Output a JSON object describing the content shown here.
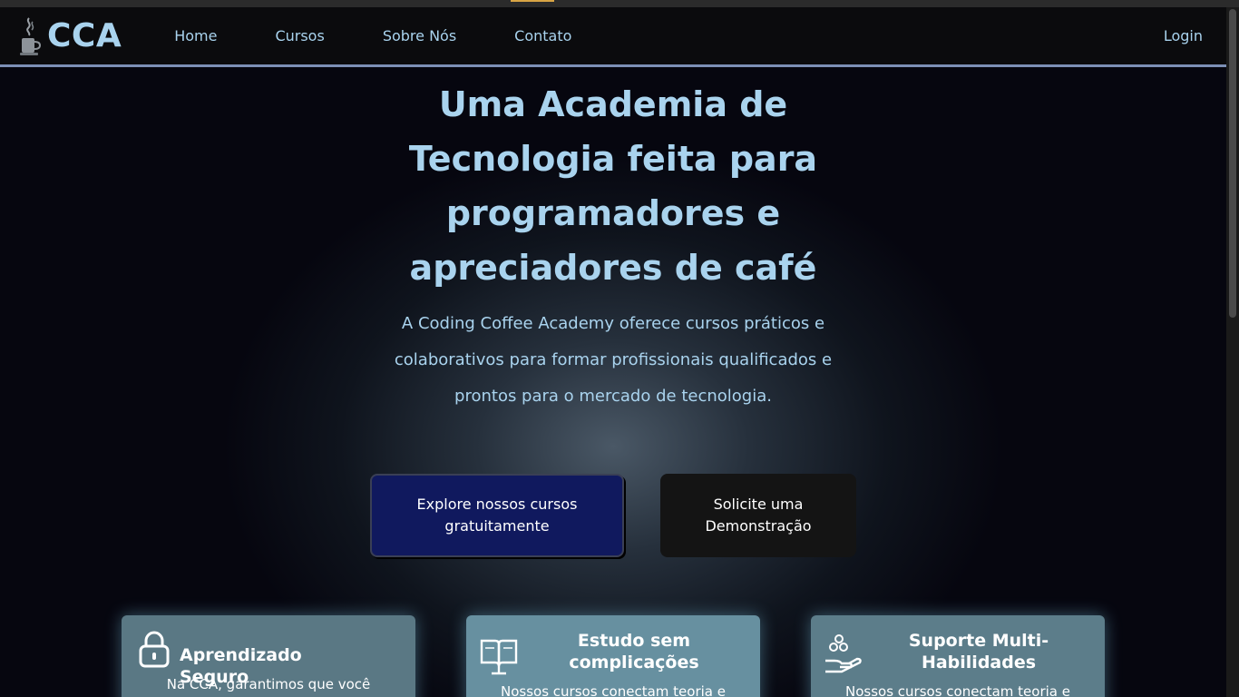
{
  "brand": {
    "name": "CCA",
    "logo_icon": "coffee-cup-icon"
  },
  "nav": {
    "items": [
      {
        "label": "Home"
      },
      {
        "label": "Cursos"
      },
      {
        "label": "Sobre Nós"
      },
      {
        "label": "Contato"
      }
    ],
    "login_label": "Login"
  },
  "hero": {
    "title_lines": [
      "Uma Academia de",
      "Tecnologia feita para",
      "programadores e",
      "apreciadores de café"
    ],
    "description_lines": [
      "A Coding Coffee Academy oferece cursos práticos e",
      "colaborativos para formar profissionais qualificados e",
      "prontos para o mercado de tecnologia."
    ],
    "primary_button_lines": [
      "Explore nossos cursos",
      "gratuitamente"
    ],
    "secondary_button_lines": [
      "Solicite uma",
      "Demonstração"
    ]
  },
  "cards": [
    {
      "icon": "lock-icon",
      "title_lines": [
        "Aprendizado Seguro"
      ],
      "text": "Na CCA, garantimos que você"
    },
    {
      "icon": "book-icon",
      "title_lines": [
        "Estudo sem",
        "complicações"
      ],
      "text": "Nossos cursos conectam teoria e"
    },
    {
      "icon": "hand-coins-icon",
      "title_lines": [
        "Suporte Multi-",
        "Habilidades"
      ],
      "text": "Nossos cursos conectam teoria e"
    }
  ],
  "colors": {
    "accent_text": "#a9d3ee",
    "navbar_bg": "#0b0b0d",
    "primary_button": "#10195e",
    "secondary_button": "#141414",
    "card_bg": "#5f7e8c"
  }
}
